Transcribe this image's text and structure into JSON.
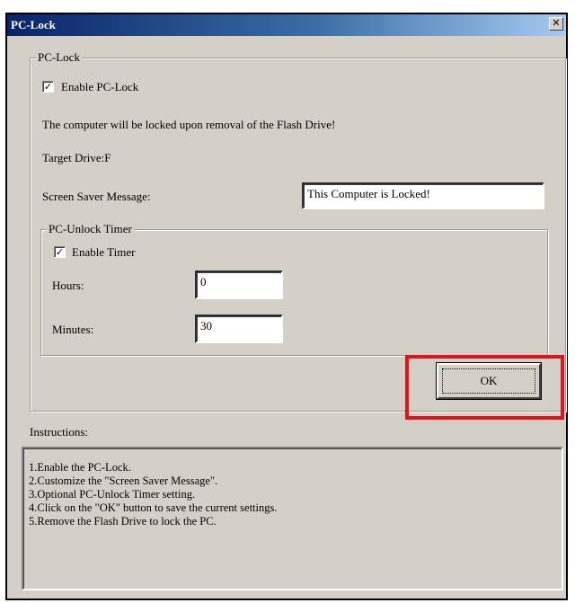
{
  "window": {
    "title": "PC-Lock",
    "close_glyph": "✕"
  },
  "pclock_group": {
    "legend": "PC-Lock",
    "enable_label": "Enable PC-Lock",
    "enable_checked": true,
    "info_text": "The computer will be locked upon removal of the Flash Drive!",
    "target_drive": "Target Drive:F",
    "ssm_label": "Screen Saver Message:",
    "ssm_value": "This Computer is Locked!"
  },
  "timer_group": {
    "legend": "PC-Unlock Timer",
    "enable_label": "Enable Timer",
    "enable_checked": true,
    "hours_label": "Hours:",
    "hours_value": "0",
    "minutes_label": "Minutes:",
    "minutes_value": "30"
  },
  "ok_button": {
    "label": "OK"
  },
  "highlight_color": "#e0141b",
  "instructions": {
    "label": "Instructions:",
    "lines": [
      "1.Enable the PC-Lock.",
      "2.Customize the \"Screen Saver Message\".",
      "3.Optional PC-Unlock Timer setting.",
      "4.Click on the \"OK\" button to save the current settings.",
      "5.Remove the Flash Drive to lock the PC."
    ]
  },
  "check_glyph": "✓"
}
